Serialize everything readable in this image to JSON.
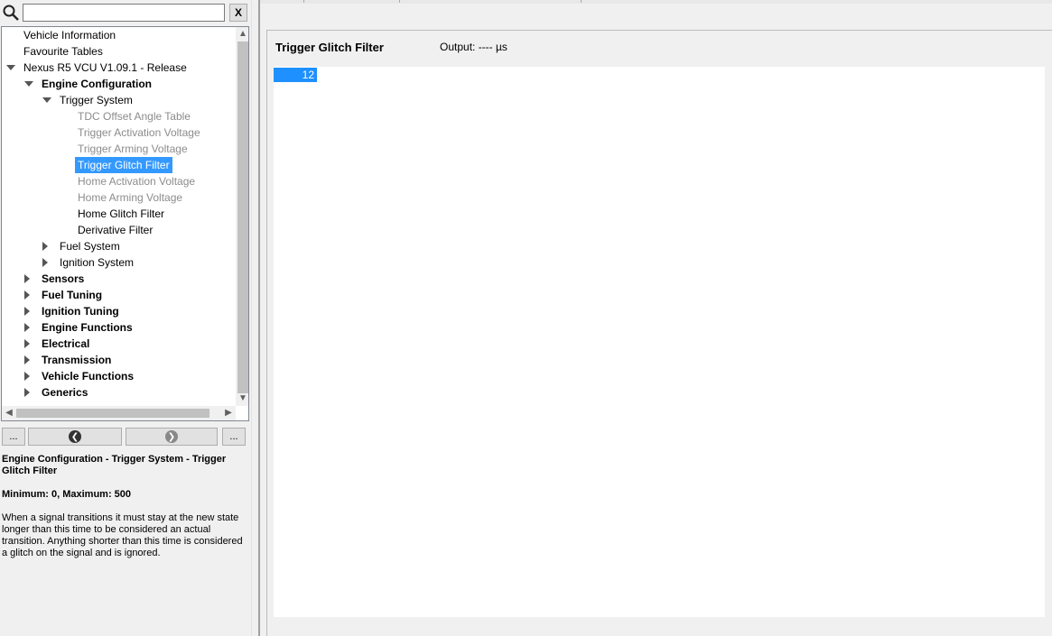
{
  "search": {
    "placeholder": "",
    "value": "",
    "clear_label": "X",
    "icon": "search-icon"
  },
  "tree": {
    "items": [
      {
        "label": "Vehicle Information",
        "level": 0,
        "state": "none",
        "style": "normal"
      },
      {
        "label": "Favourite Tables",
        "level": 0,
        "state": "none",
        "style": "normal"
      },
      {
        "label": "Nexus R5 VCU V1.09.1 - Release",
        "level": 0,
        "state": "expanded",
        "style": "normal"
      },
      {
        "label": "Engine Configuration",
        "level": 1,
        "state": "expanded",
        "style": "bold"
      },
      {
        "label": "Trigger System",
        "level": 2,
        "state": "expanded",
        "style": "normal"
      },
      {
        "label": "TDC Offset Angle Table",
        "level": 3,
        "state": "none",
        "style": "dim"
      },
      {
        "label": "Trigger Activation Voltage",
        "level": 3,
        "state": "none",
        "style": "dim"
      },
      {
        "label": "Trigger Arming Voltage",
        "level": 3,
        "state": "none",
        "style": "dim"
      },
      {
        "label": "Trigger Glitch Filter",
        "level": 3,
        "state": "none",
        "style": "sel"
      },
      {
        "label": "Home Activation Voltage",
        "level": 3,
        "state": "none",
        "style": "dim"
      },
      {
        "label": "Home Arming Voltage",
        "level": 3,
        "state": "none",
        "style": "dim"
      },
      {
        "label": "Home Glitch Filter",
        "level": 3,
        "state": "none",
        "style": "normal"
      },
      {
        "label": "Derivative Filter",
        "level": 3,
        "state": "none",
        "style": "normal"
      },
      {
        "label": "Fuel System",
        "level": 2,
        "state": "collapsed",
        "style": "normal"
      },
      {
        "label": "Ignition System",
        "level": 2,
        "state": "collapsed",
        "style": "normal"
      },
      {
        "label": "Sensors",
        "level": 1,
        "state": "collapsed",
        "style": "bold"
      },
      {
        "label": "Fuel Tuning",
        "level": 1,
        "state": "collapsed",
        "style": "bold"
      },
      {
        "label": "Ignition Tuning",
        "level": 1,
        "state": "collapsed",
        "style": "bold"
      },
      {
        "label": "Engine Functions",
        "level": 1,
        "state": "collapsed",
        "style": "bold"
      },
      {
        "label": "Electrical",
        "level": 1,
        "state": "collapsed",
        "style": "bold"
      },
      {
        "label": "Transmission",
        "level": 1,
        "state": "collapsed",
        "style": "bold"
      },
      {
        "label": "Vehicle Functions",
        "level": 1,
        "state": "collapsed",
        "style": "bold"
      },
      {
        "label": "Generics",
        "level": 1,
        "state": "collapsed",
        "style": "bold"
      }
    ]
  },
  "nav": {
    "more_left": "...",
    "more_right": "...",
    "back_icon": "chevron-left-icon",
    "forward_icon": "chevron-right-icon"
  },
  "description": {
    "path": "Engine Configuration - Trigger System - Trigger Glitch Filter",
    "range": "Minimum: 0, Maximum: 500",
    "body": "When a signal transitions it must stay at the new state longer than this time to be considered an actual transition.  Anything shorter than this time is considered a glitch on the signal and is ignored."
  },
  "table": {
    "title": "Trigger Glitch Filter",
    "output": "Output: ---- µs",
    "value": "12"
  },
  "colors": {
    "selection": "#3399ff",
    "cell": "#1e90ff"
  }
}
